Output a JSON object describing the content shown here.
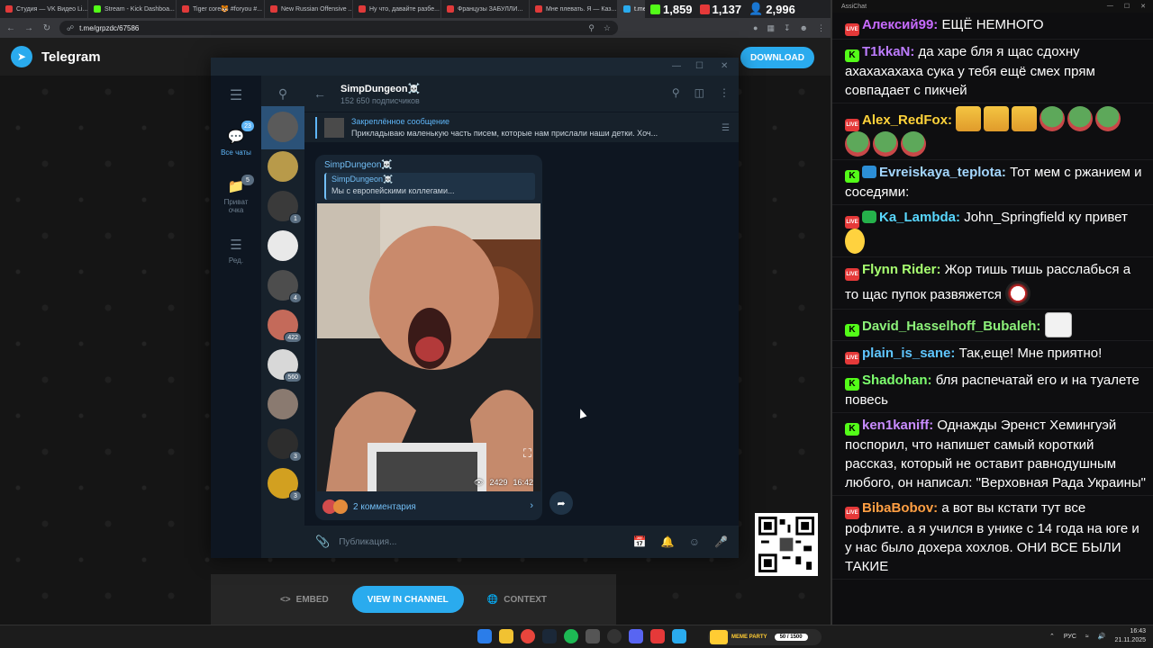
{
  "browser": {
    "tabs": [
      {
        "label": "Студия — VK Видео Li...",
        "color": "#e03a3a"
      },
      {
        "label": "Stream - Kick Dashboa...",
        "color": "#53fc18"
      },
      {
        "label": "Tiger core🐯 #foryou #...",
        "color": "#e03a3a"
      },
      {
        "label": "New Russian Offensive ...",
        "color": "#e03a3a"
      },
      {
        "label": "Ну что, давайте разбе...",
        "color": "#e03a3a"
      },
      {
        "label": "Французы ЗАБУЛЛИ...",
        "color": "#e03a3a"
      },
      {
        "label": "Мне плевать. Я — Каз...",
        "color": "#e03a3a"
      },
      {
        "label": "t.me/grpzdc",
        "color": "#2aabee"
      }
    ],
    "url": "t.me/grpzdc/67586"
  },
  "stream_counters": {
    "kick": "1,859",
    "live": "1,137",
    "viewers": "2,996"
  },
  "telegram_page": {
    "brand": "Telegram",
    "download_label": "DOWNLOAD",
    "embed_label": "EMBED",
    "view_label": "VIEW IN CHANNEL",
    "context_label": "CONTEXT"
  },
  "tg_window": {
    "folders": [
      {
        "label": "Все чаты",
        "badge": "23",
        "icon": "chat-bubble-icon"
      },
      {
        "label": "Приват очка",
        "badge": "5",
        "icon": "folder-icon"
      },
      {
        "label": "Ред.",
        "badge": "",
        "icon": "sliders-icon"
      }
    ],
    "chat_badges": [
      "",
      "",
      "1",
      "",
      "4",
      "422",
      "560",
      "",
      "3",
      "3"
    ],
    "channel": {
      "title": "SimpDungeon☠️",
      "subtitle": "152 650 подписчиков"
    },
    "pinned": {
      "title": "Закреплённое сообщение",
      "text": "Прикладываю маленькую часть писем, которые нам прислали наши детки.   Хоч..."
    },
    "message": {
      "author": "SimpDungeon☠️",
      "reply_author": "SimpDungeon☠️",
      "reply_text": "Мы с европейскими коллегами...",
      "views": "2429",
      "time": "16:42",
      "comments": "2 комментария"
    },
    "composer_placeholder": "Публикация..."
  },
  "chat": {
    "title": "AssiChat",
    "messages": [
      {
        "platform": "live",
        "name": "Алексий99",
        "color": "#c86bff",
        "text": "ЕЩЁ НЕМНОГО",
        "emotes": []
      },
      {
        "platform": "kick",
        "name": "T1kkaN",
        "color": "#bd7cff",
        "text": "да харе бля я щас сдохну ахахахахаха сука у тебя ещё смех прям совпадает с пикчей",
        "emotes": []
      },
      {
        "platform": "live",
        "name": "Alex_RedFox",
        "color": "#ffd33a",
        "text": "",
        "emotes": [
          "crying",
          "crying",
          "crying",
          "pepe",
          "pepe",
          "pepe",
          "pepe",
          "pepe",
          "pepe"
        ]
      },
      {
        "platform": "kick",
        "name": "Evreiskaya_teplota",
        "color": "#a4d7ff",
        "text": "Тот мем с ржанием и соседями:",
        "emotes": [],
        "extra_badge": "sword"
      },
      {
        "platform": "live",
        "name": "Ka_Lambda",
        "color": "#59d8ff",
        "text": "John_Springfield ку привет",
        "emotes": [
          "thumb"
        ],
        "extra_badge": "shield"
      },
      {
        "platform": "live",
        "name": "Flynn Rider",
        "color": "#a7ff70",
        "text": "Жор тишь тишь расслабься а то щас пупок развяжется",
        "emotes": [
          "joker"
        ]
      },
      {
        "platform": "kick",
        "name": "David_Hasselhoff_Bubaleh",
        "color": "#8df27a",
        "text": "",
        "emotes": [
          "memeface"
        ]
      },
      {
        "platform": "live",
        "name": "plain_is_sane",
        "color": "#5fc6ff",
        "text": "Так,еще! Мне приятно!",
        "emotes": []
      },
      {
        "platform": "kick",
        "name": "Shadohan",
        "color": "#7dff6e",
        "text": "бля распечатай его и на туалете повесь",
        "emotes": []
      },
      {
        "platform": "kick",
        "name": "ken1kaniff",
        "color": "#c88cff",
        "text": "Однажды Эренст Хемингуэй поспорил, что напишет самый короткий рассказ, который не оставит равнодушным любого, он написал: \"Верховная Рада Украины\"",
        "emotes": []
      },
      {
        "platform": "live",
        "name": "BibaBobov",
        "color": "#ff9f43",
        "text": "а вот вы кстати тут все рофлите. а я учился в унике с 14 года на юге и у нас было дохера хохлов. ОНИ ВСЕ БЫЛИ ТАКИЕ",
        "emotes": []
      }
    ]
  },
  "taskbar": {
    "party_label": "MEME PARTY",
    "party_count": "50 / 1500",
    "lang": "РУС",
    "time": "16:43",
    "date": "21.11.2025"
  }
}
